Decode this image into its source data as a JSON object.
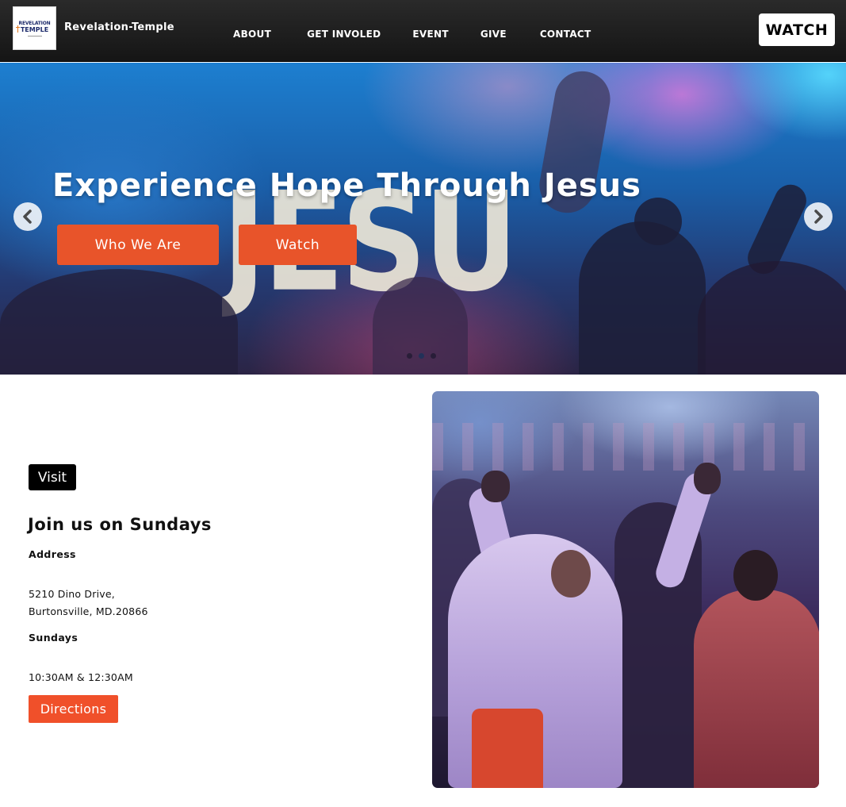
{
  "navbar": {
    "logo": {
      "line1": "REVELATION",
      "line2": "TEMPLE"
    },
    "site_name": "Revelation-Temple",
    "links": [
      "ABOUT",
      "GET INVOLED",
      "EVENT",
      "GIVE",
      "CONTACT"
    ],
    "watch_label": "WATCH"
  },
  "hero": {
    "background_word": "JESUS",
    "title": "Experience Hope Through Jesus",
    "buttons": {
      "who_we_are": "Who We Are",
      "watch": "Watch"
    },
    "carousel": {
      "slides": 3,
      "active_slide": 2
    },
    "icons": {
      "prev": "chevron-left-icon",
      "next": "chevron-right-icon"
    },
    "button_color": "#e8542a"
  },
  "visit": {
    "badge": "Visit",
    "heading": "Join us on Sundays",
    "address_label": "Address",
    "address_line1": "5210 Dino Drive,",
    "address_line2": "Burtonsville, MD.20866",
    "sundays_label": "Sundays",
    "times": "10:30AM & 12:30AM",
    "directions_label": "Directions",
    "directions_color": "#f0502a"
  }
}
